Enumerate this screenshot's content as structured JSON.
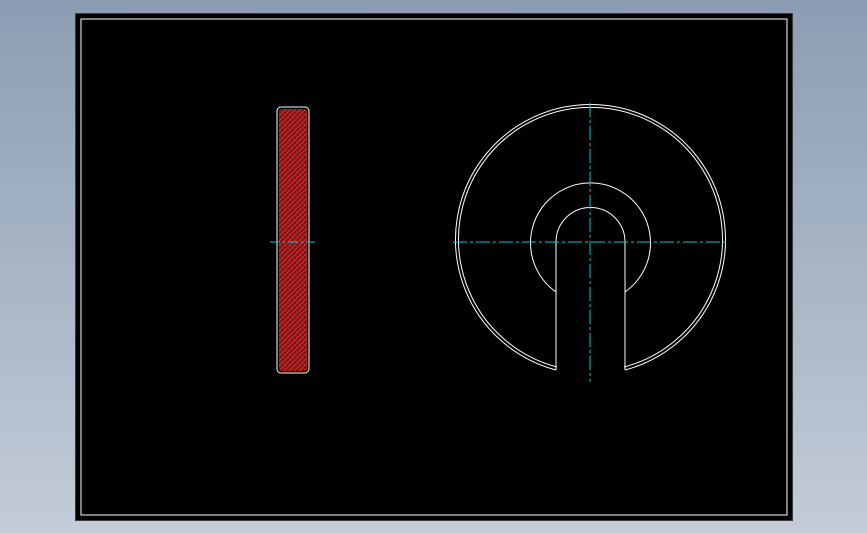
{
  "drawing": {
    "background": "#000000",
    "outline_color": "#ffffff",
    "centerline_color": "#00c8d2",
    "hatch_fill": "#7a1414",
    "hatch_line": "#ff3a3a"
  }
}
